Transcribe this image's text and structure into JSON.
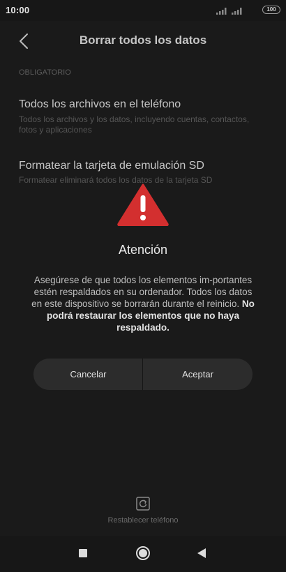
{
  "status_bar": {
    "time": "10:00",
    "battery": "100"
  },
  "header": {
    "title": "Borrar todos los datos"
  },
  "section": {
    "label": "OBLIGATORIO"
  },
  "options": [
    {
      "title": "Todos los archivos en el teléfono",
      "description": "Todos los archivos y los datos, incluyendo cuentas, contactos, fotos y aplicaciones"
    },
    {
      "title": "Formatear la tarjeta de emulación SD",
      "description": "Formatear eliminará todos los datos de la tarjeta SD"
    }
  ],
  "dialog": {
    "icon": "warning-icon",
    "title": "Atención",
    "message": "Asegúrese de que todos los elementos im-portantes estén respaldados en su ordenador. Todos los datos en este dispositivo se borrarán durante el reinicio.",
    "message_bold": "No podrá restaurar los elementos que no haya respaldado.",
    "cancel_label": "Cancelar",
    "accept_label": "Aceptar"
  },
  "footer": {
    "reset_label": "Restablecer teléfono"
  },
  "colors": {
    "background": "#1a1a1a",
    "warning_red": "#d32f2f",
    "button_bg": "#2c2c2c"
  }
}
